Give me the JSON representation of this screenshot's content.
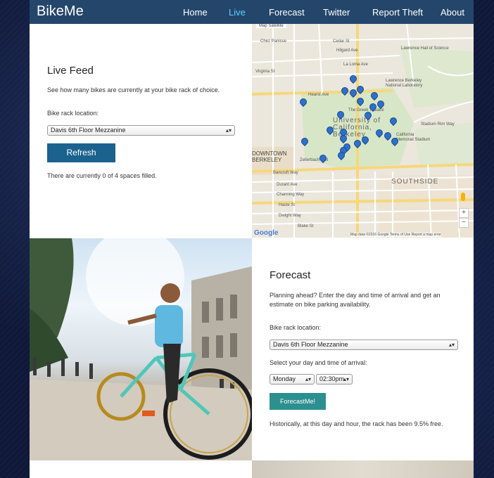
{
  "nav": {
    "brand": "BikeMe",
    "items": [
      {
        "label": "Home",
        "active": false
      },
      {
        "label": "Live",
        "active": true
      },
      {
        "label": "Forecast",
        "active": false
      },
      {
        "label": "Twitter",
        "active": false
      },
      {
        "label": "Report Theft",
        "active": false
      },
      {
        "label": "About",
        "active": false
      }
    ]
  },
  "live": {
    "title": "Live Feed",
    "description": "See how many bikes are currently at your bike rack of choice.",
    "location_label": "Bike rack location:",
    "location_value": "Davis 6th Floor Mezzanine",
    "refresh_label": "Refresh",
    "status": "There are currently 0 of 4 spaces filled."
  },
  "map": {
    "tabs": "Map   Satellite",
    "labels": {
      "chez": "Chez Panisse",
      "lawrence_hall": "Lawrence Hall of Science",
      "lbnl": "Lawrence Berkeley National Laboratory",
      "greek": "The Greek Theatre",
      "university": "University of California, Berkeley",
      "stadium": "California Memorial Stadium",
      "downtown": "DOWNTOWN BERKELEY",
      "zellerbach": "Zellerbach Hall",
      "southside": "SOUTHSIDE",
      "bancroft": "Bancroft Way",
      "durant": "Durant Ave",
      "channing": "Channing Way",
      "haste": "Haste St",
      "dwight": "Dwight Way",
      "blake": "Blake St",
      "hearst": "Hearst Ave",
      "virginia": "Virginia St",
      "cedar": "Cedar St",
      "hilgard": "Hilgard Ave",
      "lacoste": "La Loma Ave",
      "stadium_rim": "Stadium Rim Way"
    },
    "google": "Google",
    "footer": "Map data ©2016 Google   Terms of Use   Report a map error",
    "zoom_in": "+",
    "zoom_out": "−"
  },
  "forecast": {
    "title": "Forecast",
    "description": "Planning ahead? Enter the day and time of arrival and get an estimate on bike parking availability.",
    "location_label": "Bike rack location:",
    "location_value": "Davis 6th Floor Mezzanine",
    "time_label": "Select your day and time of arrival:",
    "day_value": "Monday",
    "time_value": "02:30pm",
    "button_label": "ForecastMe!",
    "result": "Historically, at this day and hour, the rack has been 9.5% free."
  },
  "colors": {
    "nav_bg": "#24466b",
    "active_nav": "#5bd0ff",
    "refresh_btn": "#1b628f",
    "forecast_btn": "#2d8f8f",
    "pin": "#2f6fcc"
  }
}
